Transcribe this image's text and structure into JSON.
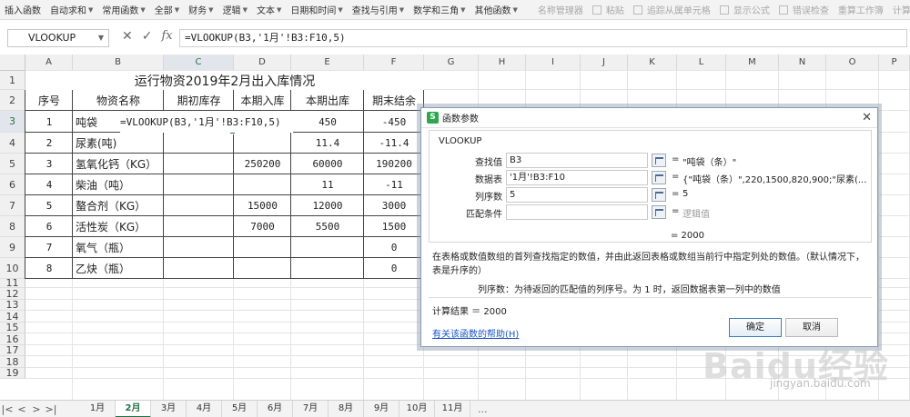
{
  "ribbon": {
    "items": [
      "插入函数",
      "自动求和",
      "常用函数",
      "全部",
      "财务",
      "逻辑",
      "文本",
      "日期和时间",
      "查找与引用",
      "数学和三角",
      "其他函数"
    ],
    "right_items": [
      "名称管理器",
      "粘贴",
      "追踪从属单元格",
      "显示公式",
      "错误检查",
      "重算工作簿",
      "计算工作表"
    ]
  },
  "formula_bar": {
    "name_box": "VLOOKUP",
    "cancel_icon": "✕",
    "enter_icon": "✓",
    "fx_label": "fx",
    "formula": "=VLOOKUP(B3,'1月'!B3:F10,5)"
  },
  "columns": [
    "A",
    "B",
    "C",
    "D",
    "E",
    "F",
    "G",
    "H",
    "I",
    "J",
    "K",
    "L",
    "M",
    "N",
    "O",
    "P"
  ],
  "rows": [
    "1",
    "2",
    "3",
    "4",
    "5",
    "6",
    "7",
    "8",
    "9",
    "10",
    "11",
    "12",
    "13",
    "14",
    "15",
    "16",
    "17",
    "18",
    "19"
  ],
  "sheet": {
    "title": "运行物资2019年2月出入库情况",
    "headers": [
      "序号",
      "物资名称",
      "期初库存",
      "本期入库",
      "本期出库",
      "期末结余"
    ],
    "data": [
      [
        "1",
        "吨袋",
        "=VLOOKUP(B3,'1月'!B3:F10,5)",
        "",
        "450",
        "-450"
      ],
      [
        "2",
        "尿素(吨)",
        "",
        "",
        "11.4",
        "-11.4"
      ],
      [
        "3",
        "氢氧化钙（KG）",
        "",
        "250200",
        "60000",
        "190200"
      ],
      [
        "4",
        "柴油（吨）",
        "",
        "",
        "11",
        "-11"
      ],
      [
        "5",
        "螯合剂（KG）",
        "",
        "15000",
        "12000",
        "3000"
      ],
      [
        "6",
        "活性炭（KG）",
        "",
        "7000",
        "5500",
        "1500"
      ],
      [
        "7",
        "氧气（瓶）",
        "",
        "",
        "",
        "0"
      ],
      [
        "8",
        "乙炔（瓶）",
        "",
        "",
        "",
        "0"
      ]
    ]
  },
  "dialog": {
    "title": "函数参数",
    "function_name": "VLOOKUP",
    "args": [
      {
        "label": "查找值",
        "value": "B3",
        "result": "\"吨袋（条）\""
      },
      {
        "label": "数据表",
        "value": "'1月'!B3:F10",
        "result": "{\"吨袋（条）\",220,1500,820,900;\"尿素(..."
      },
      {
        "label": "列序数",
        "value": "5",
        "result": "5"
      },
      {
        "label": "匹配条件",
        "value": "",
        "result": "逻辑值"
      }
    ],
    "equals": "=",
    "function_result": "= 2000",
    "description": "在表格或数值数组的首列查找指定的数值，并由此返回表格或数组当前行中指定列处的数值。（默认情况下，表是升序的）",
    "arg_description": "列序数：为待返回的匹配值的列序号。为 1 时，返回数据表第一列中的数值",
    "calc_result": "计算结果 ＝ 2000",
    "help_link": "有关该函数的帮助(H)",
    "ok_label": "确定",
    "cancel_label": "取消"
  },
  "tabs": {
    "nav": [
      "|<",
      "<",
      ">",
      ">|"
    ],
    "sheets": [
      "1月",
      "2月",
      "3月",
      "4月",
      "5月",
      "6月",
      "7月",
      "8月",
      "9月",
      "10月",
      "11月"
    ],
    "active": "2月",
    "more": "..."
  },
  "watermark": {
    "logo": "Baidu经验",
    "url": "jingyan.baidu.com"
  },
  "colors": {
    "accent": "#217346",
    "link": "#1a56c6",
    "dialog_logo": "#2da84e"
  }
}
